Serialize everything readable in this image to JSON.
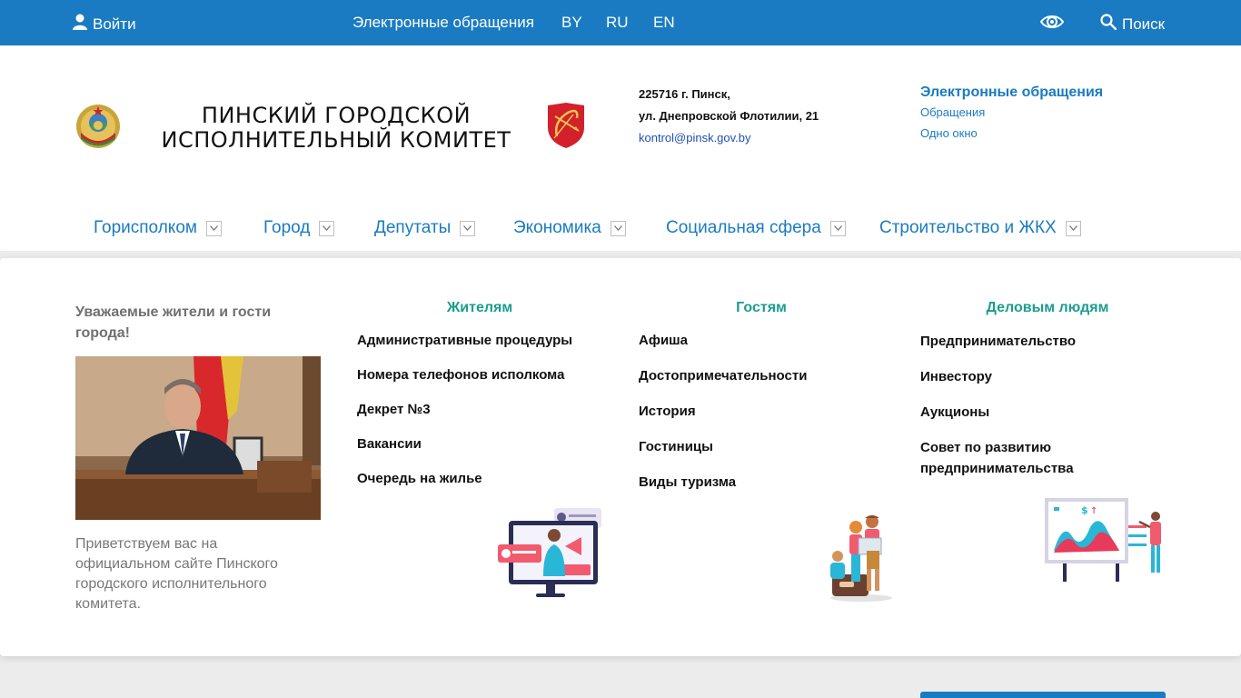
{
  "topbar": {
    "login_label": "Войти",
    "eapp_label": "Электронные обращения",
    "lang_by": "BY",
    "lang_ru": "RU",
    "lang_en": "EN",
    "search_label": "Поиск",
    "icons": [
      "user-icon",
      "eye-icon",
      "search-icon"
    ]
  },
  "header": {
    "title_line1": "ПИНСКИЙ ГОРОДСКОЙ",
    "title_line2": "ИСПОЛНИТЕЛЬНЫЙ КОМИТЕТ",
    "address_line1": "225716 г. Пинск,",
    "address_line2": "ул. Днепровской Флотилии, 21",
    "email": "kontrol@pinsk.gov.by",
    "links_title": "Электронные обращения",
    "link1": "Обращения",
    "link2": "Одно окно"
  },
  "nav": {
    "items": [
      {
        "label": "Горисполком"
      },
      {
        "label": "Город"
      },
      {
        "label": "Депутаты"
      },
      {
        "label": "Экономика"
      },
      {
        "label": "Социальная сфера"
      },
      {
        "label": "Строительство и ЖКХ"
      }
    ]
  },
  "main": {
    "greet_title": "Уважаемые жители и гости города!",
    "greet_text": "Приветствуем вас на официальном сайте Пинского городского исполнительного комитета.",
    "columns": [
      {
        "title": "Жителям",
        "links": [
          "Административные процедуры",
          "Номера телефонов исполкома",
          "Декрет №3",
          "Вакансии",
          "Очередь на жилье"
        ]
      },
      {
        "title": "Гостям",
        "links": [
          "Афиша",
          "Достопримечательности",
          "История",
          "Гостиницы",
          "Виды туризма"
        ]
      },
      {
        "title": "Деловым людям",
        "links": [
          "Предпринимательство",
          "Инвестору",
          "Аукционы",
          "Совет по развитию предпринимательства"
        ]
      }
    ]
  },
  "colors": {
    "brand_blue": "#1a7bc2",
    "teal": "#1a9e8f"
  }
}
